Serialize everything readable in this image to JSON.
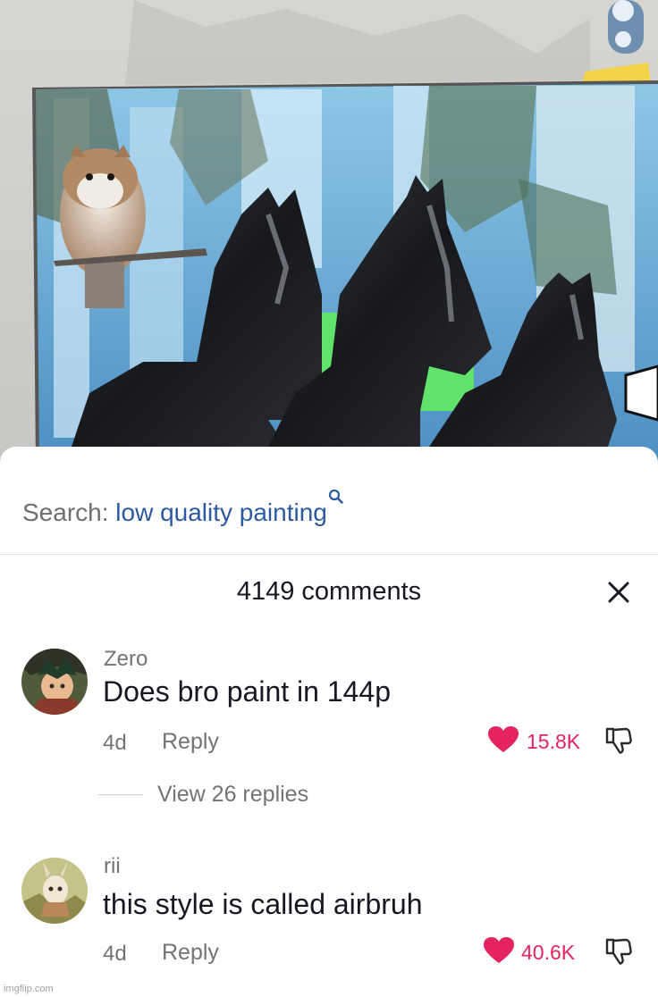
{
  "search": {
    "prefix": "Search:",
    "query": "low quality painting",
    "icon": "search-icon"
  },
  "comments_header": {
    "title": "4149 comments",
    "close_icon": "close-icon"
  },
  "comments": [
    {
      "username": "Zero",
      "text": "Does bro paint in 144p",
      "age": "4d",
      "reply_label": "Reply",
      "likes": "15.8K",
      "view_replies": "View 26 replies"
    },
    {
      "username": "rii",
      "text": "this style is called airbruh",
      "age": "4d",
      "reply_label": "Reply",
      "likes": "40.6K"
    }
  ],
  "colors": {
    "like": "#e3245f",
    "search_query": "#2c5aa0",
    "muted_text": "#737378",
    "primary_text": "#161823"
  },
  "watermark": "imgflip.com"
}
